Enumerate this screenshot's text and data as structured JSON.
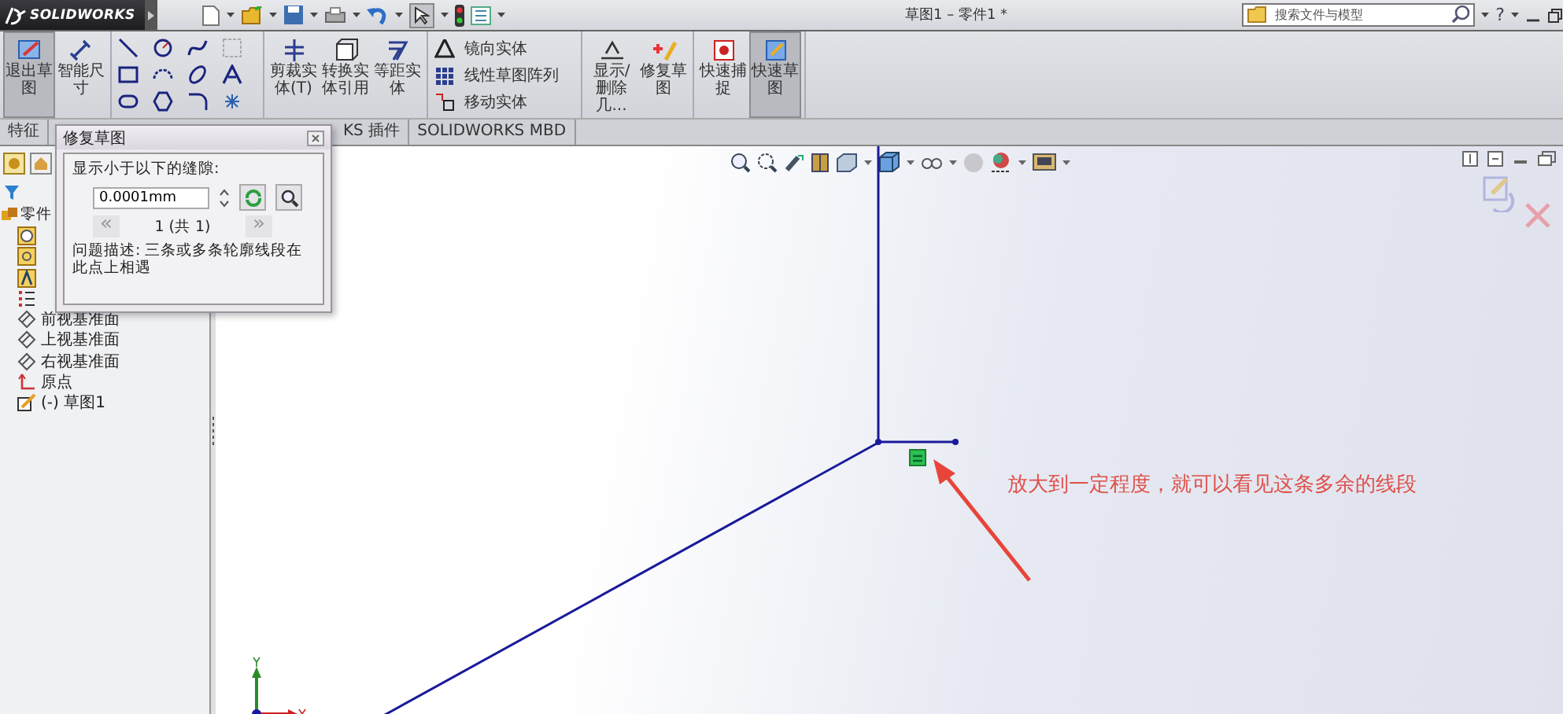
{
  "app": {
    "logo": "SOLIDWORKS",
    "title": "草图1 – 零件1 *",
    "search": {
      "placeholder": "搜索文件与模型"
    },
    "help": "?"
  },
  "ribbon": {
    "groups": [
      {
        "kind": "large",
        "buttons": [
          {
            "kind": "exit",
            "label": "退出草图",
            "selected": true
          },
          {
            "kind": "dimension",
            "label": "智能尺寸",
            "selected": false
          }
        ]
      },
      {
        "kind": "tools"
      },
      {
        "kind": "large",
        "buttons": [
          {
            "kind": "trim",
            "label": "剪裁实体(T)",
            "selected": false
          },
          {
            "kind": "convert",
            "label": "转换实体引用",
            "selected": false
          },
          {
            "kind": "offset",
            "label": "等距实体",
            "selected": false
          }
        ]
      },
      {
        "kind": "list",
        "items": [
          {
            "kind": "mirror",
            "label": "镜向实体"
          },
          {
            "kind": "pattern",
            "label": "线性草图阵列"
          },
          {
            "kind": "move",
            "label": "移动实体"
          }
        ]
      },
      {
        "kind": "large",
        "buttons": [
          {
            "kind": "relations",
            "label": "显示/删除几...",
            "selected": false
          },
          {
            "kind": "repair",
            "label": "修复草图",
            "selected": false
          }
        ]
      },
      {
        "kind": "large",
        "buttons": [
          {
            "kind": "snap",
            "label": "快速捕捉",
            "selected": false
          },
          {
            "kind": "quick",
            "label": "快速草图",
            "selected": true
          }
        ]
      }
    ]
  },
  "tabs": [
    {
      "label": "特征",
      "selected": false
    },
    {
      "label": "KS 插件",
      "selected": false
    },
    {
      "label": "SOLIDWORKS MBD",
      "selected": false
    }
  ],
  "tree": {
    "root": {
      "label": "零件",
      "children": [
        {
          "kind": "history"
        },
        {
          "kind": "sensor"
        },
        {
          "kind": "annotation"
        },
        {
          "kind": "material"
        },
        {
          "kind": "plane",
          "label": "前视基准面"
        },
        {
          "kind": "plane",
          "label": "上视基准面"
        },
        {
          "kind": "plane",
          "label": "右视基准面"
        },
        {
          "kind": "origin",
          "label": "原点"
        },
        {
          "kind": "sketch",
          "label": "(-) 草图1"
        }
      ]
    }
  },
  "dialog": {
    "title": "修复草图",
    "gap_label": "显示小于以下的缝隙:",
    "gap_value": "0.0001mm",
    "prev": {
      "label": "«",
      "disabled": true
    },
    "pager": "1 (共 1)",
    "next": {
      "label": "»",
      "disabled": true
    },
    "description": "问题描述:  三条或多条轮廓线段在此点上相遇"
  },
  "canvas": {
    "annotation": "放大到一定程度，就可以看见这条多余的线段"
  }
}
